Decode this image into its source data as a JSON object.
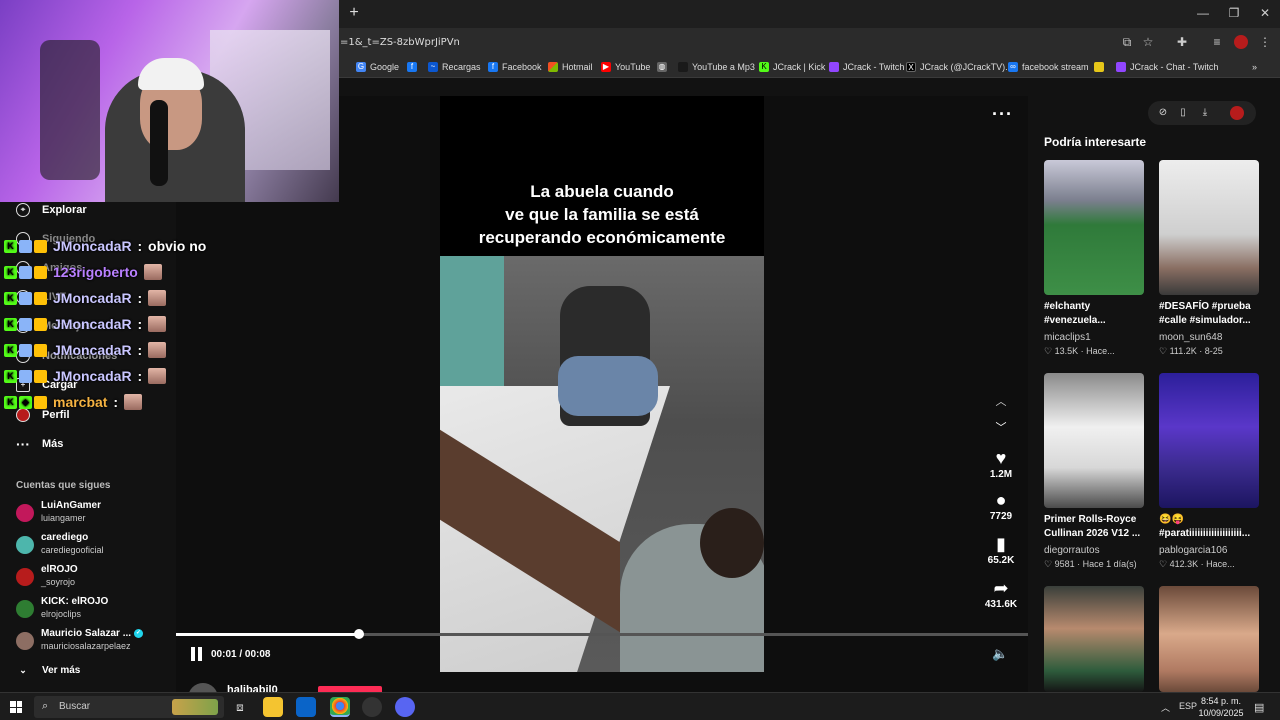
{
  "browser": {
    "url": "=1&_t=ZS-8zbWprJiPVn",
    "bookmarks": [
      "Google",
      "",
      "Recargas",
      "Facebook",
      "Hotmail",
      "YouTube",
      "",
      "YouTube a Mp3",
      "JCrack | Kick",
      "JCrack - Twitch",
      "JCrack (@JCrackTV)...",
      "facebook stream",
      "JCrack - Chat - Twitch"
    ]
  },
  "sidebar": {
    "nav": [
      {
        "label": "Explorar"
      },
      {
        "label": "Siguiendo"
      },
      {
        "label": "Amigos"
      },
      {
        "label": "LIVE"
      },
      {
        "label": "Mensajes"
      },
      {
        "label": "Notificaciones"
      },
      {
        "label": "Cargar"
      },
      {
        "label": "Perfil"
      },
      {
        "label": "Más"
      }
    ],
    "following_title": "Cuentas que sigues",
    "accounts": [
      {
        "name": "LuiAnGamer",
        "handle": "luiangamer",
        "color": "#c2185b"
      },
      {
        "name": "carediego",
        "handle": "carediegooficial",
        "color": "#4db6ac"
      },
      {
        "name": "elROJO",
        "handle": "_soyrojo",
        "color": "#b71c1c"
      },
      {
        "name": "KICK: elROJO",
        "handle": "elrojoclips",
        "color": "#2e7d32"
      },
      {
        "name": "Mauricio Salazar ...",
        "handle": "mauriciosalazarpelaez",
        "color": "#8d6e63"
      }
    ],
    "see_more": "Ver más"
  },
  "chat": [
    {
      "user": "JMoncadaR",
      "message": "obvio no",
      "color": "#c9c6ff"
    },
    {
      "user": "123rigoberto",
      "message": "",
      "color": "#b980ff"
    },
    {
      "user": "JMoncadaR",
      "message": "",
      "color": "#c9c6ff"
    },
    {
      "user": "JMoncadaR",
      "message": "",
      "color": "#c9c6ff"
    },
    {
      "user": "JMoncadaR",
      "message": "",
      "color": "#c9c6ff"
    },
    {
      "user": "JMoncadaR",
      "message": "",
      "color": "#c9c6ff"
    },
    {
      "user": "marcbat",
      "message": "",
      "color": "#f5b342"
    }
  ],
  "video": {
    "caption": [
      "La abuela cuando",
      "ve que la familia se está",
      "recuperando económicamente"
    ],
    "likes": "1.2M",
    "comments": "7729",
    "saves": "65.2K",
    "shares": "431.6K",
    "time": "00:01 / 00:08",
    "progress": 0.215,
    "author": "halibabil0"
  },
  "recommendations": {
    "title": "Podría interesarte",
    "items": [
      {
        "title": "#elchanty #venezuela...",
        "author": "micaclips1",
        "likes": "13.5K",
        "date": "Hace..."
      },
      {
        "title": "#DESAFÍO #prueba #calle #simulador...",
        "author": "moon_sun648",
        "likes": "111.2K",
        "date": "8-25"
      },
      {
        "title": "Primer Rolls-Royce Cullinan 2026 V12 ...",
        "author": "diegorrautos",
        "likes": "9581",
        "date": "Hace 1 día(s)"
      },
      {
        "title": "😆😝 #paratiiiiiiiiiiiiiiiiiii...",
        "author": "pablogarcia106",
        "likes": "412.3K",
        "date": "Hace..."
      },
      {
        "title": "",
        "author": "",
        "likes": "",
        "date": ""
      },
      {
        "title": "",
        "author": "",
        "likes": "",
        "date": ""
      }
    ]
  },
  "taskbar": {
    "search": "Buscar",
    "lang": "ESP",
    "time": "8:54 p. m.",
    "date": "10/09/2025"
  }
}
